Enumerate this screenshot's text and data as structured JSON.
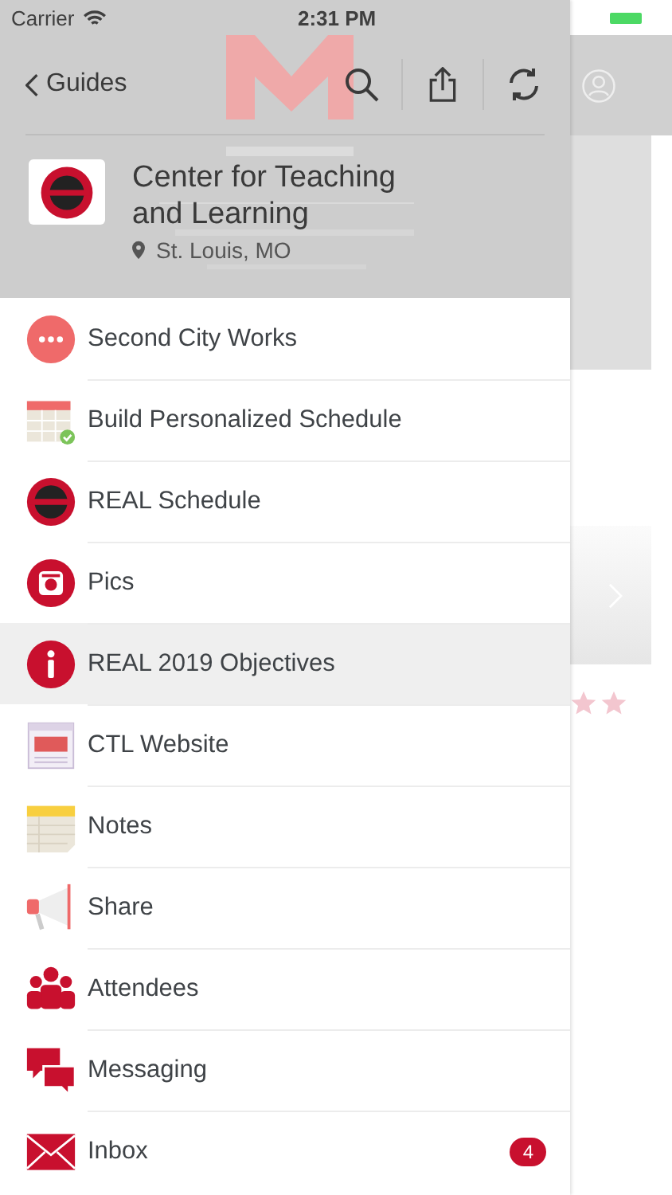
{
  "status_bar": {
    "carrier": "Carrier",
    "time": "2:31 PM"
  },
  "nav": {
    "back_label": "Guides"
  },
  "guide": {
    "title": "Center for Teaching and Learning",
    "location": "St. Louis, MO"
  },
  "menu": [
    {
      "label": "Second City Works",
      "kind": "dots",
      "selected": false
    },
    {
      "label": "Build Personalized Schedule",
      "kind": "calendar",
      "selected": false
    },
    {
      "label": "REAL Schedule",
      "kind": "logo",
      "selected": false
    },
    {
      "label": "Pics",
      "kind": "camera",
      "selected": false
    },
    {
      "label": "REAL 2019 Objectives",
      "kind": "info",
      "selected": true
    },
    {
      "label": "CTL Website",
      "kind": "website",
      "selected": false
    },
    {
      "label": "Notes",
      "kind": "notes",
      "selected": false
    },
    {
      "label": "Share",
      "kind": "megaphone",
      "selected": false
    },
    {
      "label": "Attendees",
      "kind": "people",
      "selected": false
    },
    {
      "label": "Messaging",
      "kind": "chat",
      "selected": false
    },
    {
      "label": "Inbox",
      "kind": "mail",
      "selected": false,
      "badge": "4"
    }
  ]
}
